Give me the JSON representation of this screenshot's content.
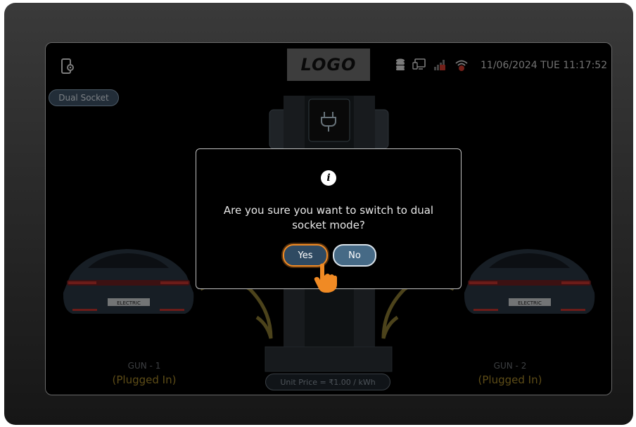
{
  "header": {
    "logo": "LOGO",
    "datetime": "11/06/2024 TUE 11:17:52",
    "icons": [
      "phone-settings-icon",
      "database-icon",
      "monitor-icon",
      "signal-off-icon",
      "wifi-error-icon"
    ]
  },
  "mode_toggle": {
    "label": "Dual Socket"
  },
  "guns": [
    {
      "label": "GUN - 1",
      "status": "(Plugged In)"
    },
    {
      "label": "GUN - 2",
      "status": "(Plugged In)"
    }
  ],
  "cars": [
    {
      "plate": "ELECTRIC"
    },
    {
      "plate": "ELECTRIC"
    }
  ],
  "price": {
    "label": "Unit Price = ₹1.00 / kWh"
  },
  "dialog": {
    "icon": "info-icon",
    "message": "Are you sure you want to switch to dual socket mode?",
    "yes_label": "Yes",
    "no_label": "No"
  },
  "colors": {
    "accent": "#f08a24",
    "status": "#a98b2a",
    "button": "#466a86"
  }
}
